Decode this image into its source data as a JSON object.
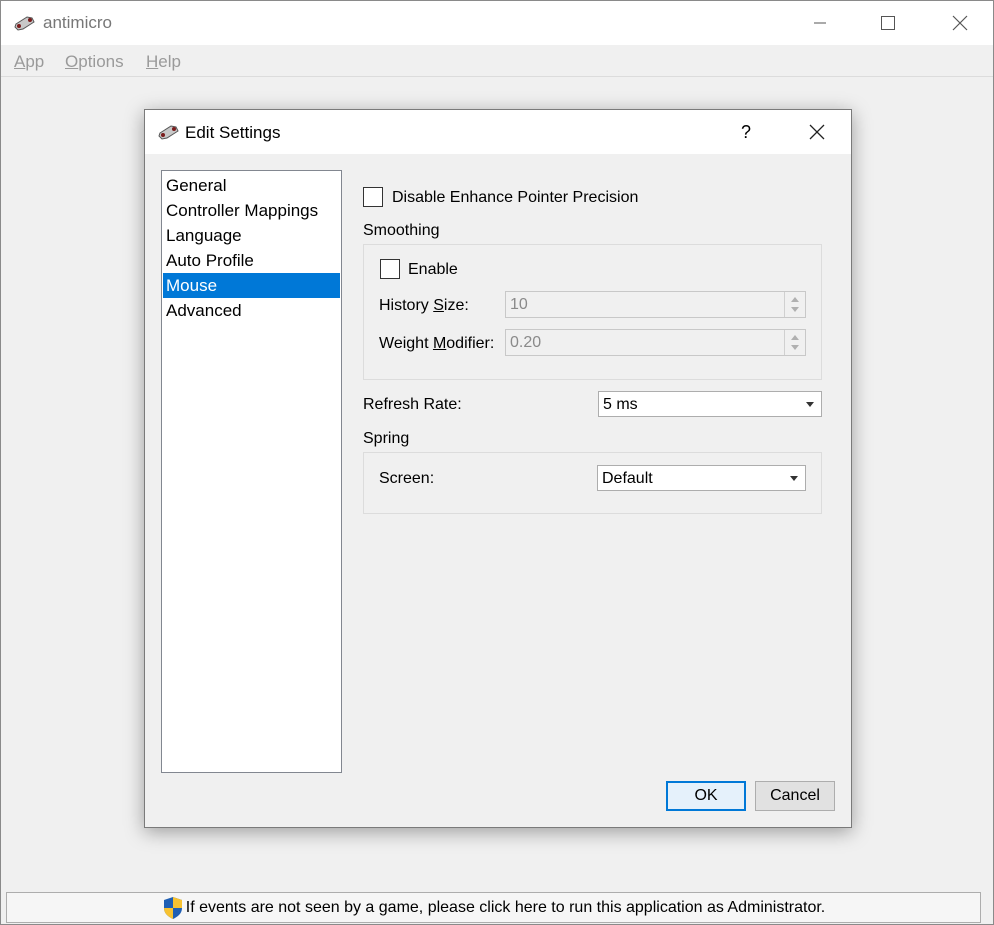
{
  "app": {
    "title": "antimicro",
    "menu": [
      {
        "label": "App",
        "mnemonic": "A",
        "rest": "pp"
      },
      {
        "label": "Options",
        "mnemonic": "O",
        "rest": "ptions"
      },
      {
        "label": "Help",
        "mnemonic": "H",
        "rest": "elp"
      }
    ],
    "admin_notice": "If events are not seen by a game, please click here to run this application as Administrator."
  },
  "dialog": {
    "title": "Edit Settings",
    "help_label": "?",
    "categories": [
      "General",
      "Controller Mappings",
      "Language",
      "Auto Profile",
      "Mouse",
      "Advanced"
    ],
    "selected_category": "Mouse",
    "mouse": {
      "disable_precision_label": "Disable Enhance Pointer Precision",
      "disable_precision_checked": false,
      "smoothing": {
        "group_label": "Smoothing",
        "enable_label": "Enable",
        "enable_checked": false,
        "history_size_label": {
          "pre": "History ",
          "mnemonic": "S",
          "post": "ize:"
        },
        "history_size_value": "10",
        "weight_modifier_label": {
          "pre": "Weight ",
          "mnemonic": "M",
          "post": "odifier:"
        },
        "weight_modifier_value": "0.20"
      },
      "refresh_rate_label": "Refresh Rate:",
      "refresh_rate_value": "5 ms",
      "spring": {
        "group_label": "Spring",
        "screen_label": "Screen:",
        "screen_value": "Default"
      }
    },
    "ok_label": "OK",
    "cancel_label": "Cancel"
  }
}
